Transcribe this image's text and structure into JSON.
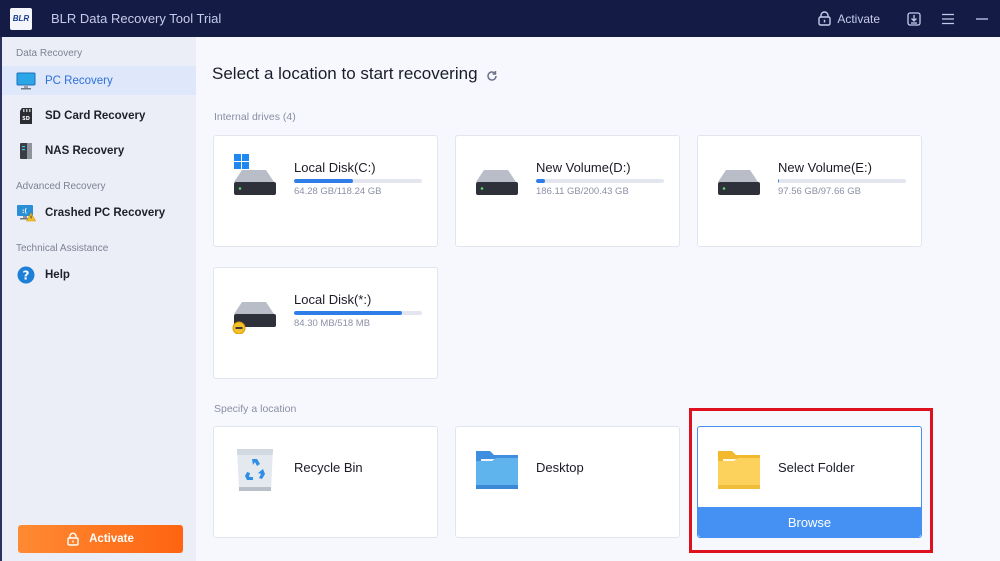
{
  "app": {
    "title": "BLR Data Recovery Tool Trial",
    "logo_text": "BLR",
    "activate_label": "Activate"
  },
  "sidebar": {
    "sections": [
      {
        "title": "Data Recovery",
        "items": [
          {
            "label": "PC Recovery",
            "icon": "monitor-icon",
            "active": true
          },
          {
            "label": "SD Card Recovery",
            "icon": "sd-card-icon"
          },
          {
            "label": "NAS Recovery",
            "icon": "nas-icon"
          }
        ]
      },
      {
        "title": "Advanced Recovery",
        "items": [
          {
            "label": "Crashed PC Recovery",
            "icon": "crashed-pc-icon"
          }
        ]
      },
      {
        "title": "Technical Assistance",
        "items": [
          {
            "label": "Help",
            "icon": "help-icon"
          }
        ]
      }
    ],
    "activate_button": "Activate"
  },
  "main": {
    "title": "Select a location to start recovering",
    "internal_label": "Internal drives (4)",
    "drives": [
      {
        "name": "Local Disk(C:)",
        "size": "64.28 GB/118.24 GB",
        "fill_percent": 46,
        "icon": "windows-drive-icon"
      },
      {
        "name": "New Volume(D:)",
        "size": "186.11 GB/200.43 GB",
        "fill_percent": 7,
        "icon": "drive-icon"
      },
      {
        "name": "New Volume(E:)",
        "size": "97.56 GB/97.66 GB",
        "fill_percent": 1,
        "icon": "drive-icon"
      },
      {
        "name": "Local Disk(*:)",
        "size": "84.30 MB/518 MB",
        "fill_percent": 84,
        "icon": "drive-warning-icon"
      }
    ],
    "specify_label": "Specify a location",
    "locations": [
      {
        "name": "Recycle Bin",
        "icon": "recycle-bin-icon"
      },
      {
        "name": "Desktop",
        "icon": "desktop-folder-icon"
      },
      {
        "name": "Select Folder",
        "icon": "folder-icon",
        "button": "Browse"
      }
    ]
  },
  "colors": {
    "titlebar": "#141c45",
    "accent": "#2f7de6",
    "activate_orange": "#ff6f1e",
    "browse_blue": "#4490f3",
    "highlight_red": "#e0111f"
  }
}
